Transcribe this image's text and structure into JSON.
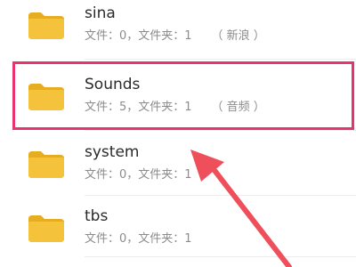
{
  "folders": [
    {
      "name": "sina",
      "files_label": "文件：0，文件夹：1",
      "tag": "（ 新浪 ）",
      "icon": "folder-icon"
    },
    {
      "name": "Sounds",
      "files_label": "文件：5，文件夹：1",
      "tag": "（ 音频 ）",
      "icon": "folder-icon"
    },
    {
      "name": "system",
      "files_label": "文件：0，文件夹：1",
      "tag": "",
      "icon": "folder-icon"
    },
    {
      "name": "tbs",
      "files_label": "文件：0，文件夹：1",
      "tag": "",
      "icon": "folder-icon"
    }
  ],
  "colors": {
    "folder": "#f5c33b",
    "folder_dark": "#e6ad21",
    "highlight": "#e8336d",
    "arrow": "#ef4f5a"
  },
  "annotation": {
    "highlighted_folder": "Sounds"
  }
}
